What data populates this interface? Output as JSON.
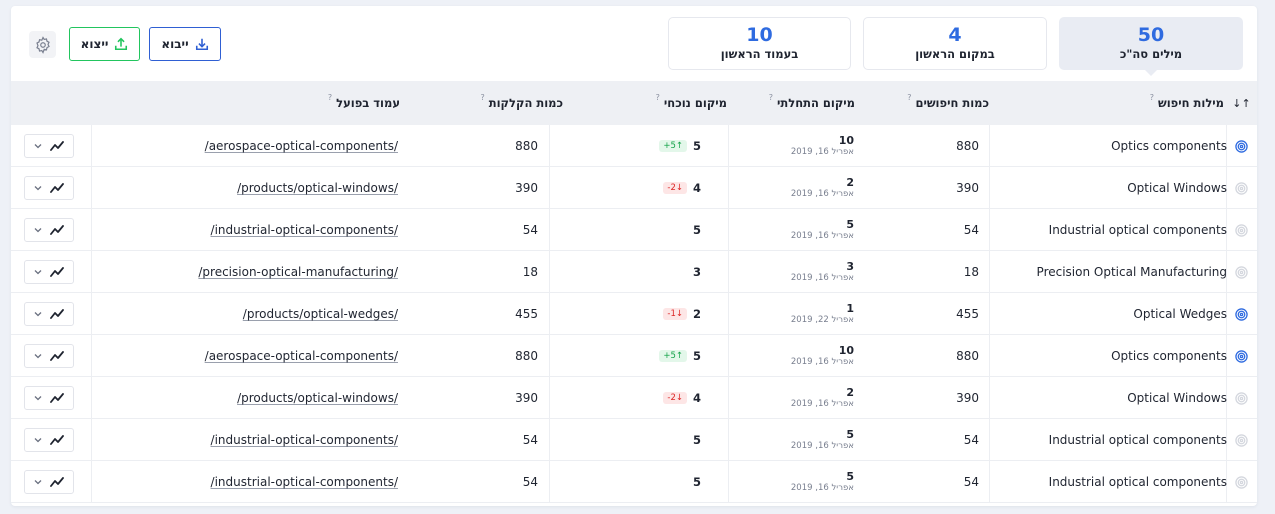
{
  "header": {
    "export_label": "ייצוא",
    "import_label": "ייבוא",
    "stats": [
      {
        "value": "50",
        "label": "מילים סה\"כ",
        "selected": true
      },
      {
        "value": "4",
        "label": "במקום הראשון",
        "selected": false
      },
      {
        "value": "10",
        "label": "בעמוד הראשון",
        "selected": false
      }
    ]
  },
  "table": {
    "columns": {
      "keyword": "מילות חיפוש",
      "volume": "כמות חיפושים",
      "start_position": "מיקום התחלתי",
      "current_position": "מיקום נוכחי",
      "clicks": "כמות הקלקות",
      "page": "עמוד בפועל",
      "help": "?",
      "sort": "↓↑"
    },
    "rows": [
      {
        "keyword": "Optics components",
        "target_active": true,
        "volume": "880",
        "start_pos": "10",
        "start_date": "אפריל 16, 2019",
        "current_pos": "5",
        "delta": "+5↑",
        "delta_dir": "up",
        "clicks": "880",
        "url": "/aerospace-optical-components/"
      },
      {
        "keyword": "Optical Windows",
        "target_active": false,
        "volume": "390",
        "start_pos": "2",
        "start_date": "אפריל 16, 2019",
        "current_pos": "4",
        "delta": "-2↓",
        "delta_dir": "down",
        "clicks": "390",
        "url": "/products/optical-windows/"
      },
      {
        "keyword": "Industrial optical components",
        "target_active": false,
        "volume": "54",
        "start_pos": "5",
        "start_date": "אפריל 16, 2019",
        "current_pos": "5",
        "delta": "",
        "delta_dir": "",
        "clicks": "54",
        "url": "/industrial-optical-components/"
      },
      {
        "keyword": "Precision Optical Manufacturing",
        "target_active": false,
        "volume": "18",
        "start_pos": "3",
        "start_date": "אפריל 16, 2019",
        "current_pos": "3",
        "delta": "",
        "delta_dir": "",
        "clicks": "18",
        "url": "/precision-optical-manufacturing/"
      },
      {
        "keyword": "Optical Wedges",
        "target_active": true,
        "volume": "455",
        "start_pos": "1",
        "start_date": "אפריל 22, 2019",
        "current_pos": "2",
        "delta": "-1↓",
        "delta_dir": "down",
        "clicks": "455",
        "url": "/products/optical-wedges/"
      },
      {
        "keyword": "Optics components",
        "target_active": true,
        "volume": "880",
        "start_pos": "10",
        "start_date": "אפריל 16, 2019",
        "current_pos": "5",
        "delta": "+5↑",
        "delta_dir": "up",
        "clicks": "880",
        "url": "/aerospace-optical-components/"
      },
      {
        "keyword": "Optical Windows",
        "target_active": false,
        "volume": "390",
        "start_pos": "2",
        "start_date": "אפריל 16, 2019",
        "current_pos": "4",
        "delta": "-2↓",
        "delta_dir": "down",
        "clicks": "390",
        "url": "/products/optical-windows/"
      },
      {
        "keyword": "Industrial optical components",
        "target_active": false,
        "volume": "54",
        "start_pos": "5",
        "start_date": "אפריל 16, 2019",
        "current_pos": "5",
        "delta": "",
        "delta_dir": "",
        "clicks": "54",
        "url": "/industrial-optical-components/"
      },
      {
        "keyword": "Industrial optical components",
        "target_active": false,
        "volume": "54",
        "start_pos": "5",
        "start_date": "אפריל 16, 2019",
        "current_pos": "5",
        "delta": "",
        "delta_dir": "",
        "clicks": "54",
        "url": "/industrial-optical-components/"
      }
    ]
  },
  "colors": {
    "accent": "#2f6be0",
    "export_border": "#22c55e",
    "import_border": "#2f5fd3",
    "up": "#16a34a",
    "down": "#dc2626"
  },
  "icons": {
    "settings": "gear-icon",
    "export": "upload-icon",
    "import": "download-icon",
    "target": "target-icon",
    "trend": "trend-line-icon",
    "expand": "chevron-down-icon"
  }
}
